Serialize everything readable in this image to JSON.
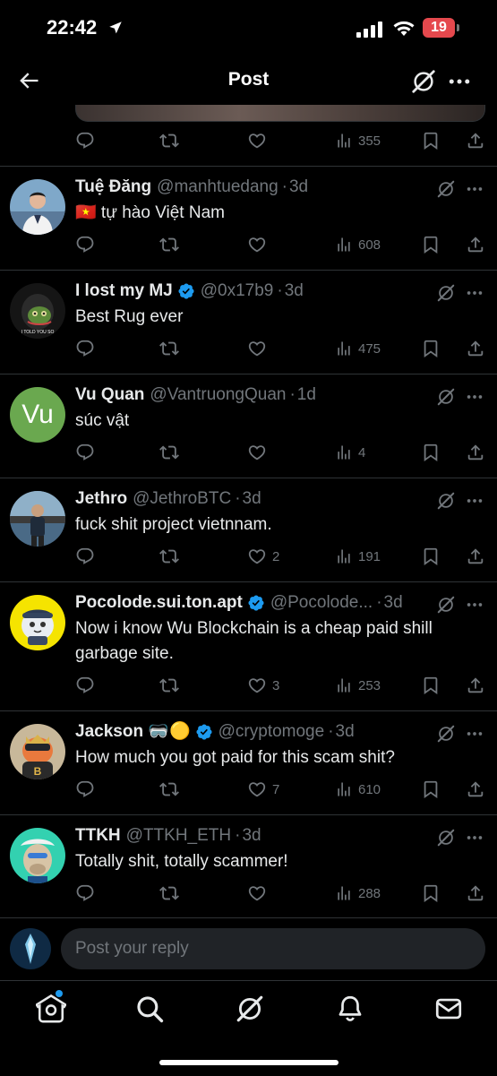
{
  "status_bar": {
    "time": "22:42",
    "battery": "19"
  },
  "header": {
    "title": "Post"
  },
  "top_post_actions": {
    "views": "355"
  },
  "composer": {
    "placeholder": "Post your reply"
  },
  "replies": [
    {
      "name": "Tuệ Đăng",
      "handle": "@manhtuedang",
      "time": "3d",
      "verified": false,
      "text": "🇻🇳 tự hào Việt Nam",
      "likes": "",
      "views": "608"
    },
    {
      "name": "I lost my MJ",
      "handle": "@0x17b9",
      "time": "3d",
      "verified": true,
      "text": "Best Rug ever",
      "likes": "",
      "views": "475",
      "avatar_caption": "I TOLD YOU SO"
    },
    {
      "name": "Vu Quan",
      "handle": "@VantruongQuan",
      "time": "1d",
      "verified": false,
      "text": "súc vật",
      "likes": "",
      "views": "4",
      "avatar_initials": "Vu"
    },
    {
      "name": "Jethro",
      "handle": "@JethroBTC",
      "time": "3d",
      "verified": false,
      "text": "fuck shit project vietnnam.",
      "likes": "2",
      "views": "191"
    },
    {
      "name": "Pocolode.sui.ton.apt",
      "handle": "@Pocolode...",
      "time": "3d",
      "verified": true,
      "text": "Now i know Wu Blockchain is a cheap paid shill garbage site.",
      "likes": "3",
      "views": "253"
    },
    {
      "name": "Jackson 🥽🟡",
      "handle": "@cryptomoge",
      "time": "3d",
      "verified": true,
      "text": "How much you got paid for this scam shit?",
      "likes": "7",
      "views": "610"
    },
    {
      "name": "TTKH",
      "handle": "@TTKH_ETH",
      "time": "3d",
      "verified": false,
      "text": "Totally shit, totally scammer!",
      "likes": "",
      "views": "288"
    }
  ],
  "colors": {
    "background": "#000000",
    "text": "#e7e9ea",
    "muted": "#71767b",
    "accent": "#1d9bf0",
    "divider": "#2f3336",
    "battery": "#e5484d"
  },
  "icons": [
    "back-arrow-icon",
    "grok-icon",
    "more-icon",
    "reply-icon",
    "repost-icon",
    "like-icon",
    "views-icon",
    "bookmark-icon",
    "share-icon",
    "home-icon",
    "search-icon",
    "bell-icon",
    "mail-icon"
  ]
}
